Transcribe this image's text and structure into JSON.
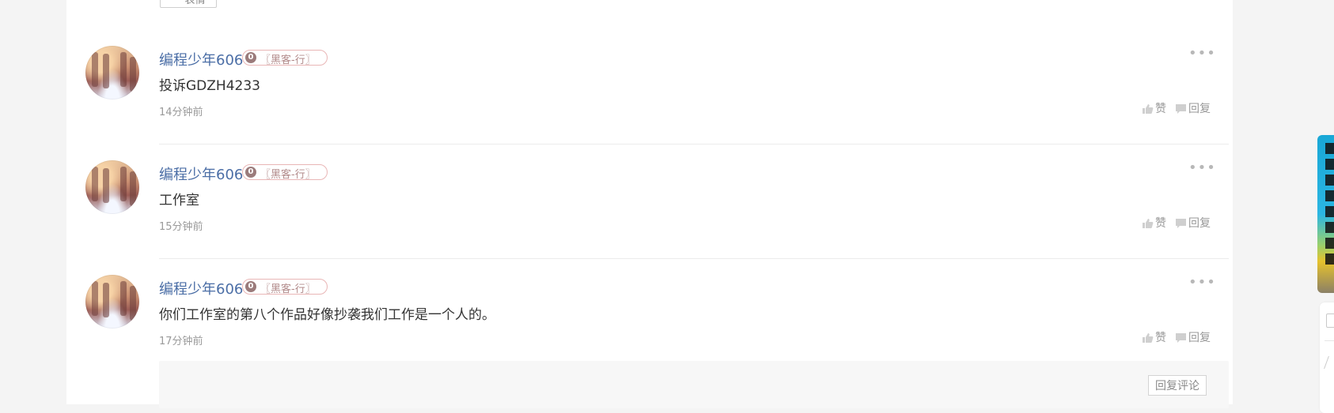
{
  "colors": {
    "page_bg": "#f4f4f4",
    "panel_bg": "#ffffff",
    "username": "#4b6ea6",
    "badge_border": "#e9b6b6",
    "badge_text": "#b28a8a",
    "muted": "#9a9a9a"
  },
  "top_button": {
    "label": "··· 表情"
  },
  "comments": [
    {
      "username": "编程少年606",
      "badge_level": "0",
      "badge_title": "〖黑客-行〗",
      "text": "投诉GDZH4233",
      "time": "14分钟前",
      "like_label": "赞",
      "reply_label": "回复",
      "more_icon": "ellipsis-icon"
    },
    {
      "username": "编程少年606",
      "badge_level": "0",
      "badge_title": "〖黑客-行〗",
      "text": "工作室",
      "time": "15分钟前",
      "like_label": "赞",
      "reply_label": "回复",
      "more_icon": "ellipsis-icon"
    },
    {
      "username": "编程少年606",
      "badge_level": "0",
      "badge_title": "〖黑客-行〗",
      "text": "你们工作室的第八个作品好像抄袭我们工作是一个人的。",
      "time": "17分钟前",
      "like_label": "赞",
      "reply_label": "回复",
      "more_icon": "ellipsis-icon"
    }
  ],
  "reply_box": {
    "button_label": "回复评论"
  }
}
